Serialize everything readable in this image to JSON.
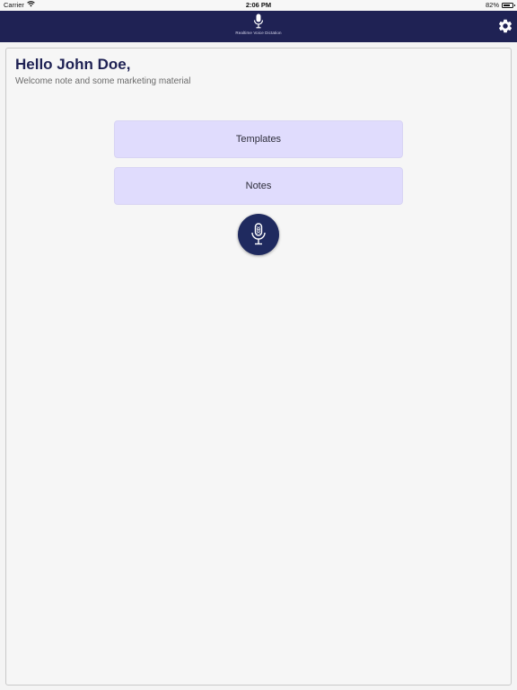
{
  "status_bar": {
    "carrier": "Carrier",
    "time": "2:06 PM",
    "battery": "82%",
    "battery_level": 0.82
  },
  "nav": {
    "logo_text": "Realtime Voice Dictation",
    "icons": {
      "logo": "microphone-icon",
      "settings": "gear-icon"
    }
  },
  "main": {
    "greeting": "Hello John Doe,",
    "welcome": "Welcome note and some marketing material",
    "buttons": [
      {
        "label": "Templates"
      },
      {
        "label": "Notes"
      }
    ],
    "mic_icon": "microphone-icon"
  },
  "colors": {
    "nav_background": "#1f2254",
    "button_background": "#e0dcfd",
    "mic_button": "#1f2a5f",
    "greeting": "#1f2254"
  }
}
